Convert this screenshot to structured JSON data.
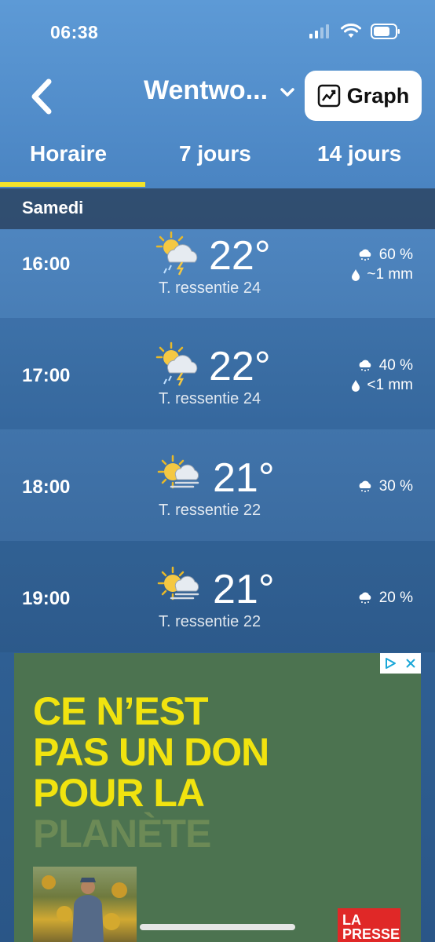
{
  "status_bar": {
    "time": "06:38"
  },
  "header": {
    "location": "Wentwo...",
    "graph_label": "Graph"
  },
  "tabs": [
    {
      "label": "Horaire",
      "selected": true
    },
    {
      "label": "7 jours",
      "selected": false
    },
    {
      "label": "14 jours",
      "selected": false
    }
  ],
  "day_label": "Samedi",
  "hours": [
    {
      "time": "16:00",
      "icon": "sun-cloud-thunder-rain-icon",
      "temp": "22°",
      "feels": "T. ressentie 24",
      "precip_prob": "60 %",
      "precip_amount": "~1 mm"
    },
    {
      "time": "17:00",
      "icon": "sun-cloud-thunder-rain-icon",
      "temp": "22°",
      "feels": "T. ressentie 24",
      "precip_prob": "40 %",
      "precip_amount": "<1 mm"
    },
    {
      "time": "18:00",
      "icon": "sun-cloud-haze-icon",
      "temp": "21°",
      "feels": "T. ressentie 22",
      "precip_prob": "30 %"
    },
    {
      "time": "19:00",
      "icon": "sun-cloud-haze-icon",
      "temp": "21°",
      "feels": "T. ressentie 22",
      "precip_prob": "20 %"
    }
  ],
  "ad": {
    "headline_lines": [
      "CE N’EST",
      "PAS UN DON",
      "POUR LA"
    ],
    "headline_dim_line": "PLANÈTE",
    "logo_text": "LA PRESSE",
    "colors": {
      "background": "#4c7350",
      "headline": "#f1e30f",
      "logo": "#e02827"
    }
  },
  "colors": {
    "tab_underline": "#f3e22a",
    "graph_button_bg": "#ffffff"
  }
}
